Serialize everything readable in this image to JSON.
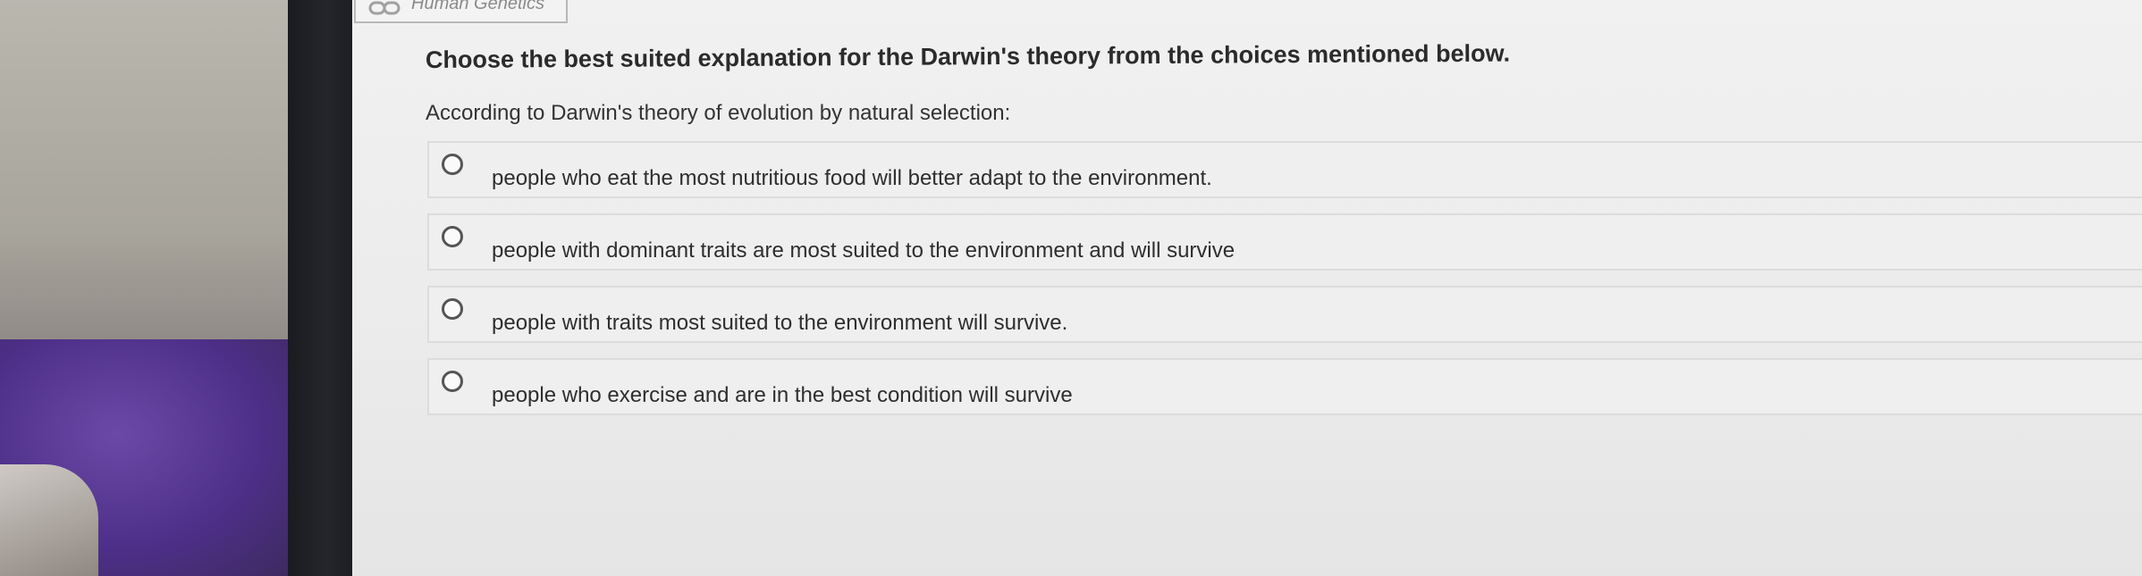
{
  "tab": {
    "label": "Human Genetics",
    "icon": "link-icon"
  },
  "question": {
    "title": "Choose the best suited explanation for the Darwin's theory from the choices mentioned below.",
    "prompt": "According to Darwin's theory of evolution by natural selection:"
  },
  "choices": [
    {
      "label": "people who eat the most nutritious food will better adapt to the environment.",
      "selected": false
    },
    {
      "label": "people with dominant traits are most suited to the environment and will survive",
      "selected": false
    },
    {
      "label": "people with traits most suited to the environment will survive.",
      "selected": false
    },
    {
      "label": "people who exercise and are in the best condition will survive",
      "selected": false
    }
  ]
}
